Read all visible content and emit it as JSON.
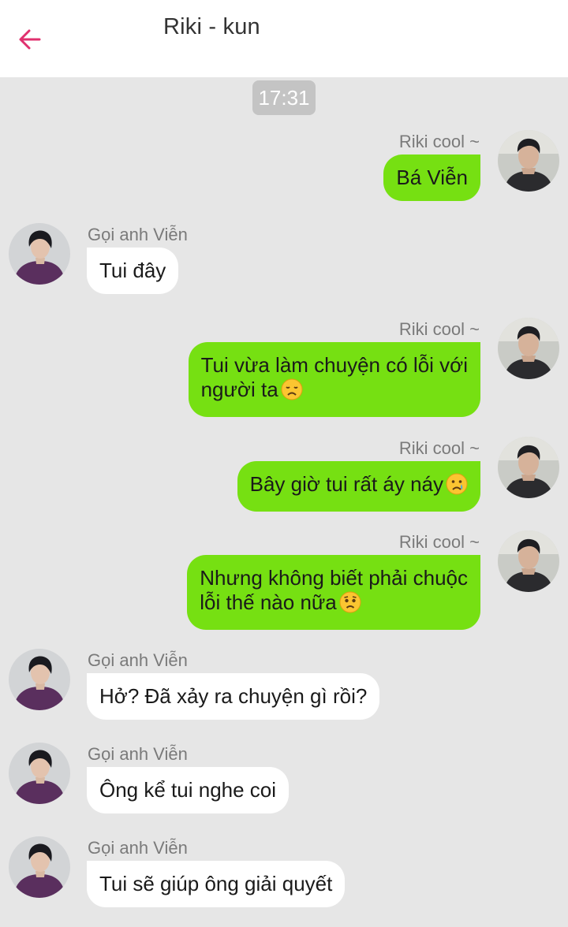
{
  "header": {
    "title": "Riki - kun",
    "back_icon": "arrow-left-icon",
    "accent": "#e0306e"
  },
  "timestamp": "17:31",
  "colors": {
    "outgoing_bubble": "#76e012",
    "incoming_bubble": "#ffffff",
    "background": "#e6e6e6"
  },
  "messages": [
    {
      "direction": "out",
      "sender": "Riki cool ~",
      "text": "Bá Viễn"
    },
    {
      "direction": "in",
      "sender": "Gọi anh Viễn",
      "text": "Tui đây"
    },
    {
      "direction": "out",
      "sender": "Riki cool ~",
      "lines": [
        "Tui vừa làm chuyện có lỗi với",
        "người ta"
      ],
      "emoji": "disappointed-face-icon"
    },
    {
      "direction": "out",
      "sender": "Riki cool ~",
      "text": "Bây giờ tui rất áy náy",
      "emoji": "crying-face-icon"
    },
    {
      "direction": "out",
      "sender": "Riki cool ~",
      "lines": [
        "Nhưng không biết phải chuộc",
        "lỗi thế nào nữa"
      ],
      "emoji": "worried-face-icon"
    },
    {
      "direction": "in",
      "sender": "Gọi anh Viễn",
      "text": "Hở? Đã xảy ra chuyện gì rồi?"
    },
    {
      "direction": "in",
      "sender": "Gọi anh Viễn",
      "text": "Ông kể tui nghe coi"
    },
    {
      "direction": "in",
      "sender": "Gọi anh Viễn",
      "text": "Tui sẽ giúp ông giải quyết"
    }
  ]
}
